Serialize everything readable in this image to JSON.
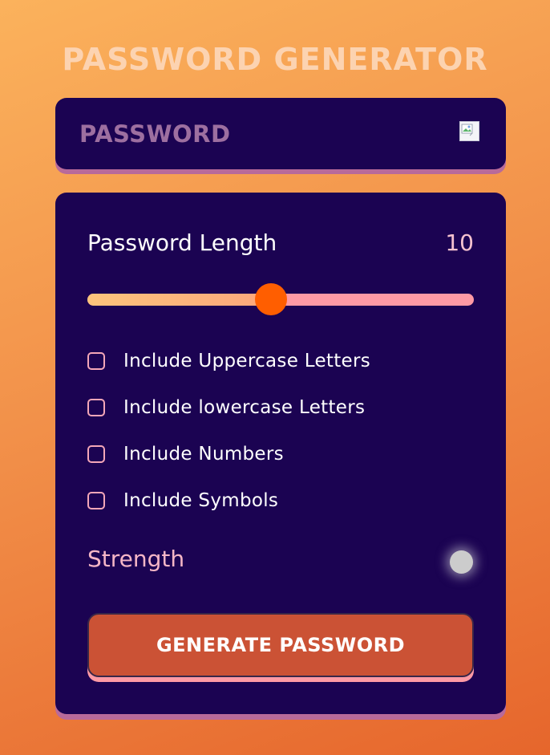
{
  "app": {
    "title": "PASSWORD GENERATOR"
  },
  "display": {
    "password_placeholder": "PASSWORD",
    "copy_icon": "broken-image-copy-icon"
  },
  "length": {
    "label": "Password Length",
    "value": "10",
    "slider_fraction": 0.475
  },
  "options": [
    {
      "label": "Include Uppercase Letters",
      "checked": false
    },
    {
      "label": "Include lowercase Letters",
      "checked": false
    },
    {
      "label": "Include Numbers",
      "checked": false
    },
    {
      "label": "Include Symbols",
      "checked": false
    }
  ],
  "strength": {
    "label": "Strength",
    "indicator_color": "#cccccc"
  },
  "actions": {
    "generate_label": "GENERATE PASSWORD"
  },
  "colors": {
    "panel": "#1b0352",
    "accent": "#ff5e00",
    "button": "#cb5235",
    "pink": "#fe9aa5"
  }
}
